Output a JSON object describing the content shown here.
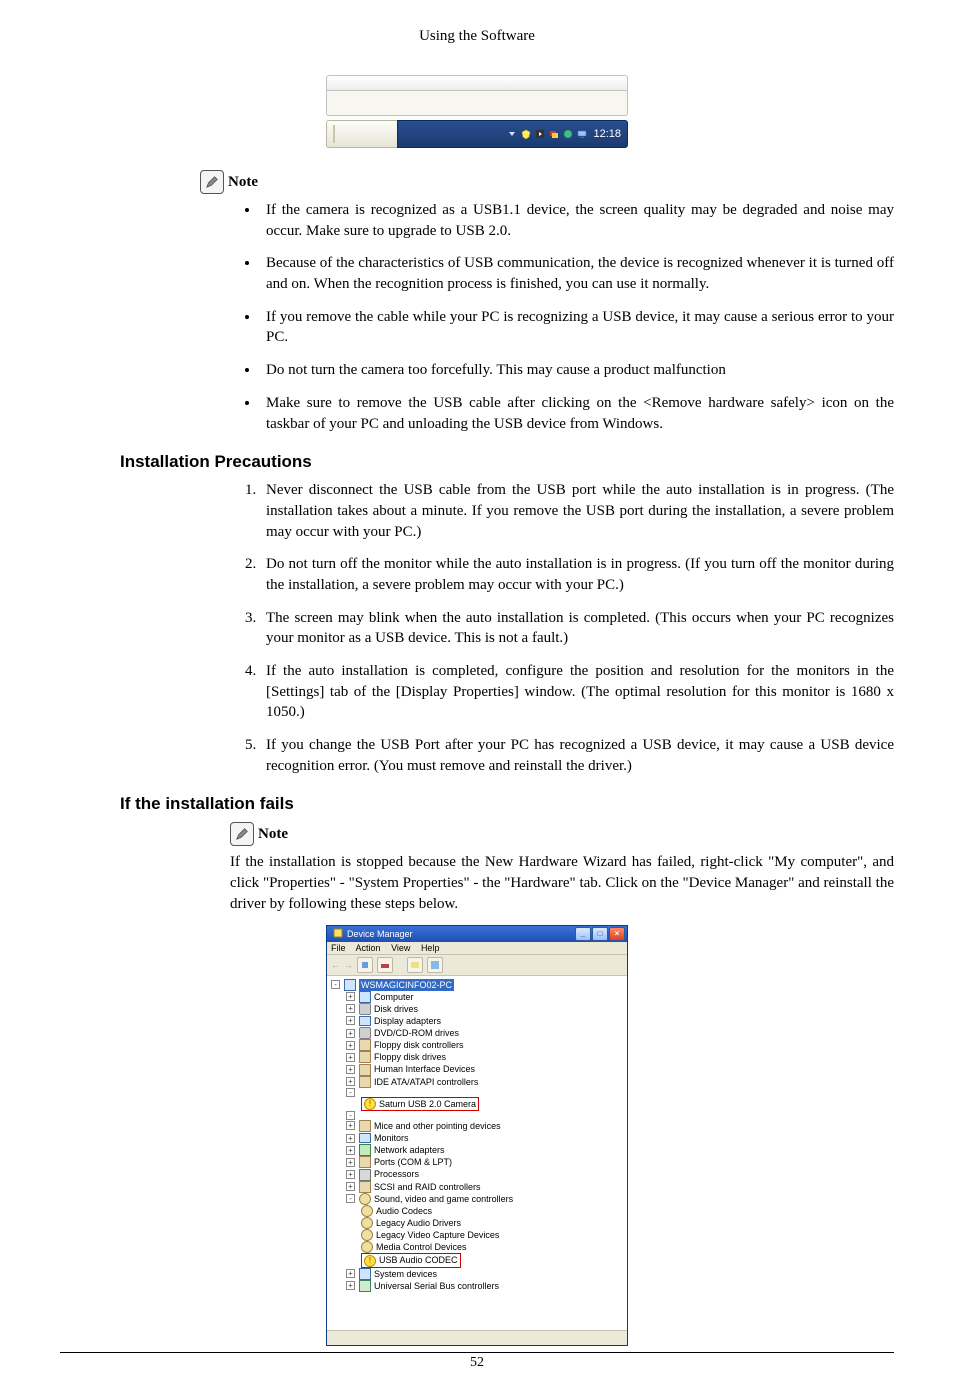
{
  "header": {
    "title": "Using the Software"
  },
  "taskbar": {
    "time": "12:18"
  },
  "note_label": "Note",
  "bullets": [
    "If the camera is recognized as a USB1.1 device, the screen quality may be degraded and noise may occur. Make sure to upgrade to USB 2.0.",
    "Because of the characteristics of USB communication, the device is recognized whenever it is turned off and on. When the recognition process is finished, you can use it normally.",
    "If you remove the cable while your PC is recognizing a USB device, it may cause a serious error to your PC.",
    "Do not turn the camera too forcefully. This may cause a product malfunction",
    "Make sure to remove the USB cable after clicking on the <Remove hardware safely> icon on the taskbar of your PC and unloading the USB device from Windows."
  ],
  "section_precautions": {
    "title": "Installation Precautions",
    "items": [
      "Never disconnect the USB cable from the USB port while the auto installation is in progress. (The installation takes about a minute. If you remove the USB port during the installation, a severe problem may occur with your PC.)",
      "Do not turn off the monitor while the auto installation is in progress. (If you turn off the monitor during the installation, a severe problem may occur with your PC.)",
      "The screen may blink when the auto installation is completed. (This occurs when your PC recognizes your monitor as a USB device. This is not a fault.)",
      "If the auto installation is completed, configure the position and resolution for the monitors in the [Settings] tab of the [Display Properties] window. (The optimal resolution for this monitor is 1680 x 1050.)",
      "If you change the USB Port after your PC has recognized a USB device, it may cause a USB device recognition error. (You must remove and reinstall the driver.)"
    ]
  },
  "section_fails": {
    "title": "If the installation fails",
    "note_label": "Note",
    "para": "If the installation is stopped because the New Hardware Wizard has failed, right-click \"My computer\", and click \"Properties\" - \"System Properties\" - the \"Hardware\" tab. Click on the \"Device Manager\" and reinstall the driver by following these steps below."
  },
  "device_manager": {
    "title": "Device Manager",
    "menus": [
      "File",
      "Action",
      "View",
      "Help"
    ],
    "root": "WSMAGICINFO02-PC",
    "warn_item_1": "Saturn USB 2.0 Camera",
    "warn_item_2": "USB Audio CODEC",
    "nodes": [
      "Computer",
      "Disk drives",
      "Display adapters",
      "DVD/CD-ROM drives",
      "Floppy disk controllers",
      "Floppy disk drives",
      "Human Interface Devices",
      "IDE ATA/ATAPI controllers"
    ],
    "middle_nodes": [
      "Mice and other pointing devices",
      "Monitors",
      "Network adapters",
      "Ports (COM & LPT)",
      "Processors",
      "SCSI and RAID controllers",
      "Sound, video and game controllers"
    ],
    "sound_children": [
      "Audio Codecs",
      "Legacy Audio Drivers",
      "Legacy Video Capture Devices",
      "Media Control Devices"
    ],
    "tail_nodes": [
      "System devices",
      "Universal Serial Bus controllers"
    ]
  },
  "page_number": "52"
}
